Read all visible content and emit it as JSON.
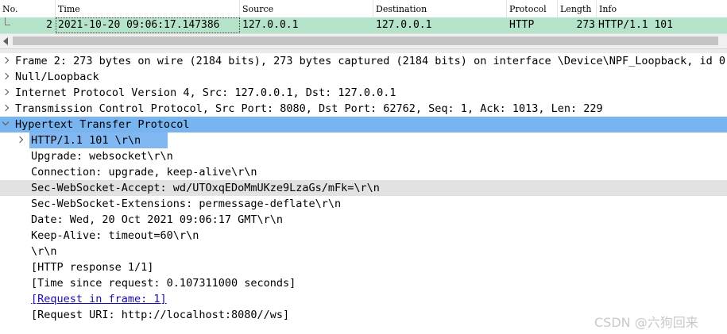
{
  "packet_list": {
    "columns": [
      "No.",
      "Time",
      "Source",
      "Destination",
      "Protocol",
      "Length",
      "Info"
    ],
    "rows": [
      {
        "no": "2",
        "time": "2021-10-20 09:06:17.147386",
        "source": "127.0.0.1",
        "destination": "127.0.0.1",
        "protocol": "HTTP",
        "length": "273",
        "info": "HTTP/1.1 101"
      }
    ],
    "row_color": "#b5e3c9"
  },
  "details": {
    "lines": [
      "Frame 2: 273 bytes on wire (2184 bits), 273 bytes captured (2184 bits) on interface \\Device\\NPF_Loopback, id 0",
      "Null/Loopback",
      "Internet Protocol Version 4, Src: 127.0.0.1, Dst: 127.0.0.1",
      "Transmission Control Protocol, Src Port: 8080, Dst Port: 62762, Seq: 1, Ack: 1013, Len: 229",
      "Hypertext Transfer Protocol",
      "HTTP/1.1 101 \\r\\n",
      "Upgrade: websocket\\r\\n",
      "Connection: upgrade, keep-alive\\r\\n",
      "Sec-WebSocket-Accept: wd/UTOxqEDoMmUKze9LzaGs/mFk=\\r\\n",
      "Sec-WebSocket-Extensions: permessage-deflate\\r\\n",
      "Date: Wed, 20 Oct 2021 09:06:17 GMT\\r\\n",
      "Keep-Alive: timeout=60\\r\\n",
      "\\r\\n",
      "[HTTP response 1/1]",
      "[Time since request: 0.107311000 seconds]",
      "[Request in frame: 1]",
      "[Request URI: http://localhost:8080//ws]"
    ],
    "selected_color": "#78b4f0"
  },
  "watermark": "CSDN @六狗回来"
}
